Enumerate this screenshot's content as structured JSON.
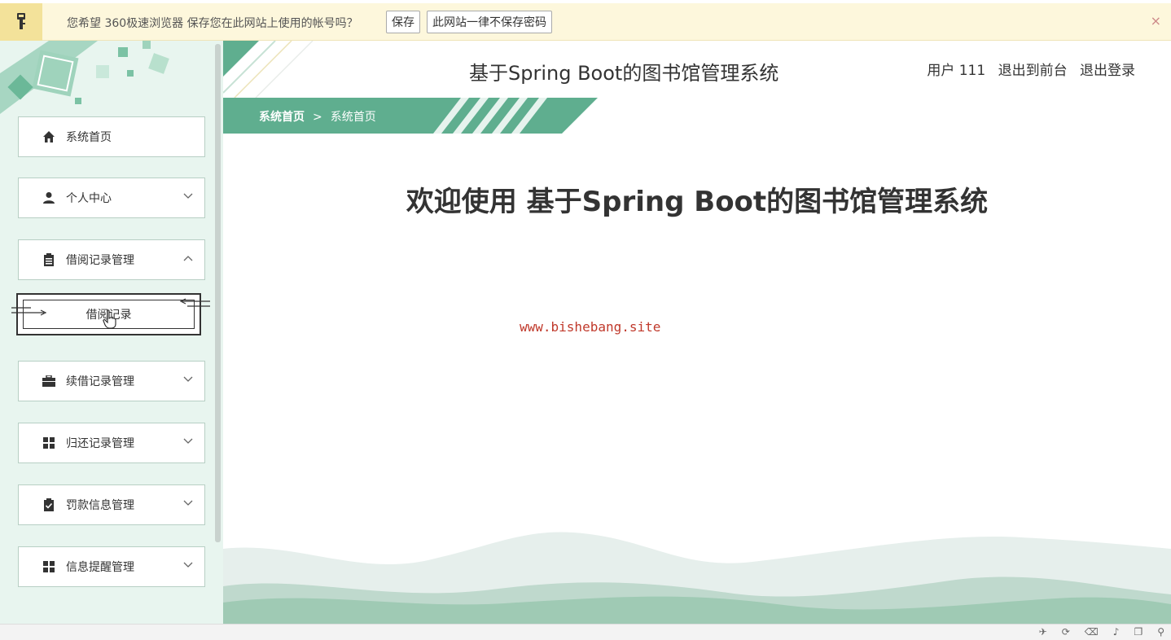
{
  "password_bar": {
    "message": "您希望 360极速浏览器 保存您在此网站上使用的帐号吗？",
    "save_label": "保存",
    "never_label": "此网站一律不保存密码",
    "close_label": "×"
  },
  "header": {
    "title": "基于Spring Boot的图书馆管理系统",
    "user": "用户 111",
    "to_front": "退出到前台",
    "logout": "退出登录"
  },
  "breadcrumb": {
    "home": "系统首页",
    "separator": ">",
    "current": "系统首页"
  },
  "sidebar": {
    "items": [
      {
        "label": "系统首页",
        "icon": "home-icon"
      },
      {
        "label": "个人中心",
        "icon": "user-icon"
      },
      {
        "label": "借阅记录管理",
        "icon": "clipboard-icon",
        "expanded": true
      },
      {
        "label": "续借记录管理",
        "icon": "briefcase-icon"
      },
      {
        "label": "归还记录管理",
        "icon": "grid-icon"
      },
      {
        "label": "罚款信息管理",
        "icon": "clipboard-check-icon"
      },
      {
        "label": "信息提醒管理",
        "icon": "grid-icon"
      }
    ],
    "sub_item": "借阅记录"
  },
  "main": {
    "welcome": "欢迎使用 基于Spring Boot的图书馆管理系统",
    "watermark": "www.bishebang.site"
  },
  "colors": {
    "accent": "#5fae8f",
    "sidebar_bg": "#e8f5ef",
    "password_bar_bg": "#fdf7dc"
  }
}
